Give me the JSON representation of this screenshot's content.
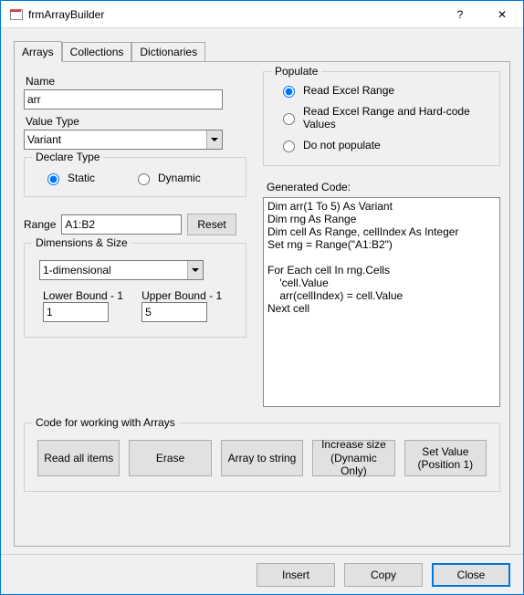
{
  "window": {
    "title": "frmArrayBuilder"
  },
  "tabs": {
    "arrays": "Arrays",
    "collections": "Collections",
    "dictionaries": "Dictionaries"
  },
  "left": {
    "name_label": "Name",
    "name_value": "arr",
    "valuetype_label": "Value Type",
    "valuetype_value": "Variant",
    "declare_legend": "Declare Type",
    "declare_static": "Static",
    "declare_dynamic": "Dynamic",
    "range_label": "Range",
    "range_value": "A1:B2",
    "reset": "Reset",
    "dims_legend": "Dimensions & Size",
    "dims_value": "1-dimensional",
    "lb_label": "Lower Bound - 1",
    "lb_value": "1",
    "ub_label": "Upper Bound - 1",
    "ub_value": "5"
  },
  "right": {
    "populate_legend": "Populate",
    "opt_read": "Read Excel Range",
    "opt_hard": "Read Excel Range and Hard-code Values",
    "opt_none": "Do not populate",
    "gen_label": "Generated Code:",
    "code": "Dim arr(1 To 5) As Variant\nDim rng As Range\nDim cell As Range, cellIndex As Integer\nSet rng = Range(\"A1:B2\")\n\nFor Each cell In rng.Cells\n    'cell.Value\n    arr(cellIndex) = cell.Value\nNext cell"
  },
  "lower": {
    "legend": "Code for working with Arrays",
    "read_all": "Read all items",
    "erase": "Erase",
    "to_string": "Array to string",
    "inc_size": "Increase size\n(Dynamic Only)",
    "set_value": "Set Value\n(Position 1)"
  },
  "footer": {
    "insert": "Insert",
    "copy": "Copy",
    "close": "Close"
  }
}
